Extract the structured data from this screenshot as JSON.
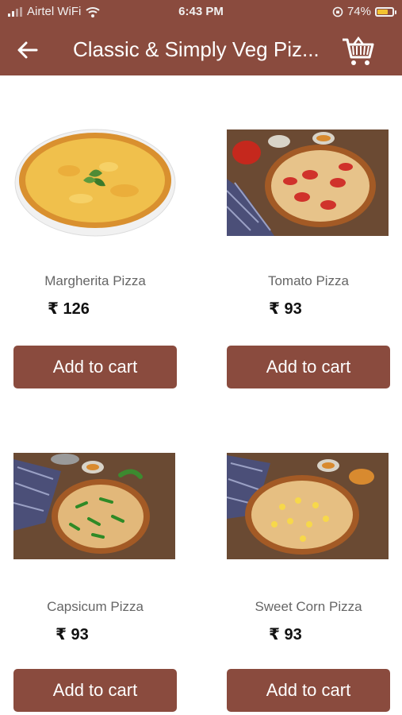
{
  "status_bar": {
    "carrier": "Airtel WiFi",
    "time": "6:43 PM",
    "battery_percent": "74%",
    "battery_level": 0.74
  },
  "header": {
    "title": "Classic & Simply Veg Piz...",
    "back_icon": "arrow-left-icon",
    "cart_icon": "shopping-cart-icon"
  },
  "products": [
    {
      "name": "Margherita Pizza",
      "price": "₹ 126",
      "button_label": "Add to cart"
    },
    {
      "name": "Tomato Pizza",
      "price": "₹ 93",
      "button_label": "Add to cart"
    },
    {
      "name": "Capsicum Pizza",
      "price": "₹ 93",
      "button_label": "Add to cart"
    },
    {
      "name": "Sweet Corn Pizza",
      "price": "₹ 93",
      "button_label": "Add to cart"
    }
  ],
  "colors": {
    "primary": "#8a4b3e"
  }
}
